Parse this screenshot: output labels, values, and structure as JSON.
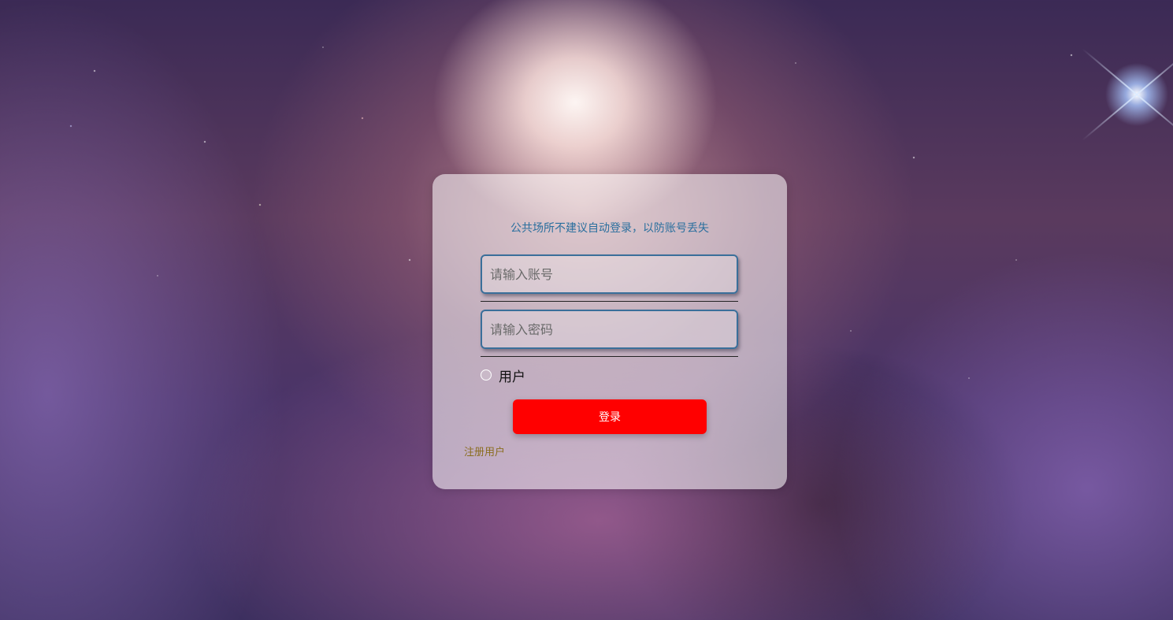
{
  "login": {
    "notice": "公共场所不建议自动登录，以防账号丢失",
    "account_placeholder": "请输入账号",
    "password_placeholder": "请输入密码",
    "role_option": "用户",
    "submit_label": "登录",
    "register_link": "注册用户"
  },
  "colors": {
    "notice_text": "#2a6f9e",
    "button_background": "#ff0000",
    "register_link": "#8a6d1f",
    "field_border": "#3a6f9a"
  }
}
